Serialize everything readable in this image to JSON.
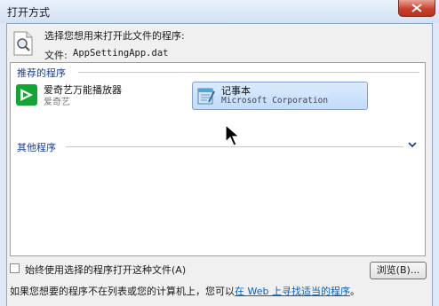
{
  "window": {
    "title": "打开方式"
  },
  "header": {
    "prompt": "选择您想用来打开此文件的程序:",
    "file_label": "文件:",
    "file_name": "AppSettingApp.dat"
  },
  "groups": {
    "recommended": "推荐的程序",
    "other": "其他程序"
  },
  "programs": [
    {
      "name": "爱奇艺万能播放器",
      "publisher": "爱奇艺",
      "icon": "iqiyi-player-icon",
      "color": "#12a434",
      "selected": false
    },
    {
      "name": "记事本",
      "publisher": "Microsoft Corporation",
      "icon": "notepad-icon",
      "selected": true
    }
  ],
  "options": {
    "always_use_label": "始终使用选择的程序打开这种文件(A)",
    "always_use_checked": false
  },
  "buttons": {
    "browse": "浏览(B)..."
  },
  "footer": {
    "text_prefix": "如果您想要的程序不在列表或您的计算机上，您可以",
    "link": "在 Web 上寻找适当的程序",
    "text_suffix": "。"
  }
}
